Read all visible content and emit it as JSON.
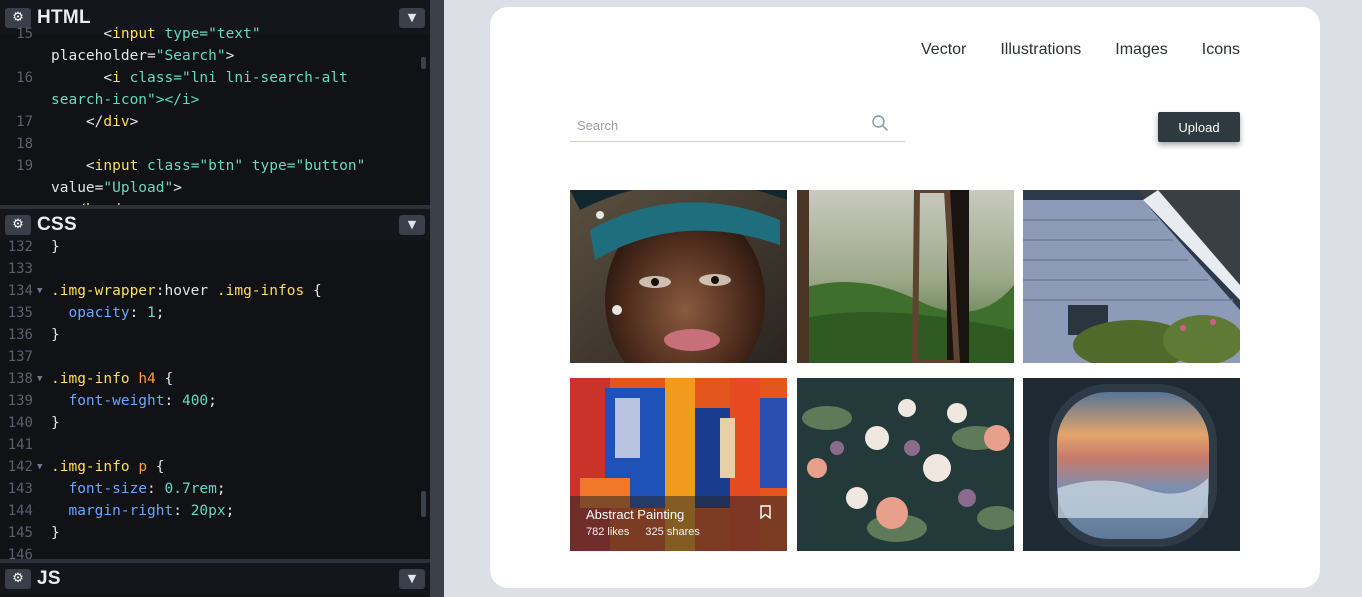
{
  "editor": {
    "panes": [
      {
        "title": "HTML",
        "gear_icon": "gear-icon",
        "toggle_icon": "chevron-down-icon"
      },
      {
        "title": "CSS",
        "gear_icon": "gear-icon",
        "toggle_icon": "chevron-down-icon"
      },
      {
        "title": "JS",
        "gear_icon": "gear-icon",
        "toggle_icon": "chevron-down-icon"
      }
    ],
    "html_lines": [
      {
        "n": "15",
        "fold": false,
        "text": "      <input type=\"text\""
      },
      {
        "n": "",
        "fold": false,
        "text": "placeholder=\"Search\">"
      },
      {
        "n": "16",
        "fold": false,
        "text": "      <i class=\"lni lni-search-alt"
      },
      {
        "n": "",
        "fold": false,
        "text": "search-icon\"></i>"
      },
      {
        "n": "17",
        "fold": false,
        "text": "    </div>"
      },
      {
        "n": "18",
        "fold": false,
        "text": ""
      },
      {
        "n": "19",
        "fold": false,
        "text": "    <input class=\"btn\" type=\"button\""
      },
      {
        "n": "",
        "fold": false,
        "text": "value=\"Upload\">"
      },
      {
        "n": "",
        "fold": false,
        "text": "  </header>"
      }
    ],
    "css_lines": [
      {
        "n": "132",
        "fold": false,
        "text": "}"
      },
      {
        "n": "133",
        "fold": false,
        "text": ""
      },
      {
        "n": "134",
        "fold": true,
        "text": ".img-wrapper:hover .img-infos {"
      },
      {
        "n": "135",
        "fold": false,
        "text": "  opacity: 1;"
      },
      {
        "n": "136",
        "fold": false,
        "text": "}"
      },
      {
        "n": "137",
        "fold": false,
        "text": ""
      },
      {
        "n": "138",
        "fold": true,
        "text": ".img-info h4 {"
      },
      {
        "n": "139",
        "fold": false,
        "text": "  font-weight: 400;"
      },
      {
        "n": "140",
        "fold": false,
        "text": "}"
      },
      {
        "n": "141",
        "fold": false,
        "text": ""
      },
      {
        "n": "142",
        "fold": true,
        "text": ".img-info p {"
      },
      {
        "n": "143",
        "fold": false,
        "text": "  font-size: 0.7rem;"
      },
      {
        "n": "144",
        "fold": false,
        "text": "  margin-right: 20px;"
      },
      {
        "n": "145",
        "fold": false,
        "text": "}"
      },
      {
        "n": "146",
        "fold": false,
        "text": ""
      }
    ]
  },
  "preview": {
    "nav": [
      "Vector",
      "Illustrations",
      "Images",
      "Icons"
    ],
    "search": {
      "placeholder": "Search",
      "icon": "search-icon"
    },
    "upload_label": "Upload",
    "gallery": [
      {
        "name": "portrait-woman-headwrap"
      },
      {
        "name": "open-window-forest"
      },
      {
        "name": "house-siding-roof"
      },
      {
        "name": "abstract-painting",
        "overlay": {
          "title": "Abstract Painting",
          "likes": "782 likes",
          "shares": "325 shares",
          "icon": "bookmark-icon"
        }
      },
      {
        "name": "flower-bouquet"
      },
      {
        "name": "airplane-window-clouds"
      }
    ]
  },
  "colors": {
    "editor_bg": "#101216",
    "preview_bg": "#dcdfe5",
    "card_bg": "#ffffff",
    "upload_bg": "#2f3a40"
  }
}
